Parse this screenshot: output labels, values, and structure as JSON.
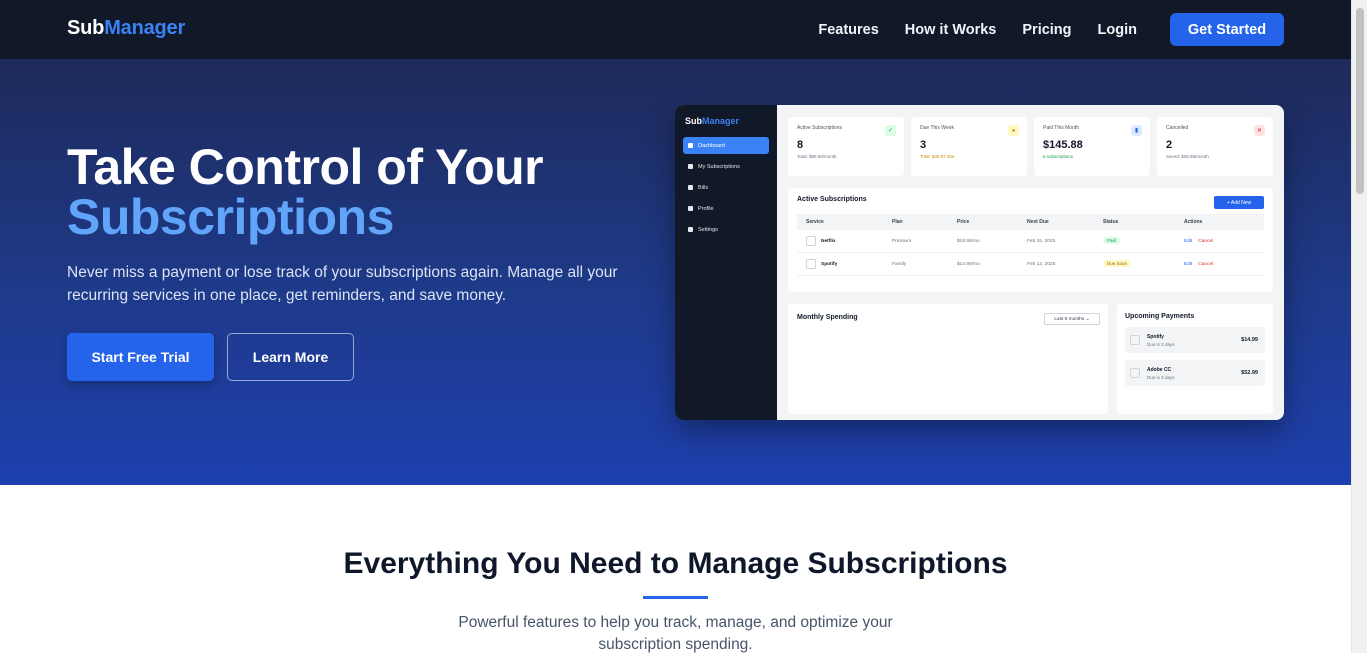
{
  "nav": {
    "logo_a": "Sub",
    "logo_b": "Manager",
    "links": [
      "Features",
      "How it Works",
      "Pricing",
      "Login"
    ],
    "cta": "Get Started"
  },
  "hero": {
    "title_line1": "Take Control of Your",
    "title_line2": "Subscriptions",
    "subtitle": "Never miss a payment or lose track of your subscriptions again. Manage all your recurring services in one place, get reminders, and save money.",
    "primary_btn": "Start Free Trial",
    "secondary_btn": "Learn More"
  },
  "preview": {
    "logo_a": "Sub",
    "logo_b": "Manager",
    "sidebar": [
      "Dashboard",
      "My Subscriptions",
      "Bills",
      "Profile",
      "Settings"
    ],
    "stats": [
      {
        "label": "Active Subscriptions",
        "value": "8",
        "note": "Total: $89.90/month",
        "icon": "✓",
        "bg": "#dcfce7",
        "fg": "#16a34a",
        "note_color": "#6b7280"
      },
      {
        "label": "Due This Week",
        "value": "3",
        "note": "Total: $35.97 due",
        "icon": "●",
        "bg": "#fef9c3",
        "fg": "#ca8a04",
        "note_color": "#ca8a04"
      },
      {
        "label": "Paid This Month",
        "value": "$145.88",
        "note": "6 subscriptions",
        "icon": "▮",
        "bg": "#dbeafe",
        "fg": "#2563eb",
        "note_color": "#16a34a"
      },
      {
        "label": "Cancelled",
        "value": "2",
        "note": "Saved: $25.98/month",
        "icon": "✕",
        "bg": "#fee2e2",
        "fg": "#dc2626",
        "note_color": "#6b7280"
      }
    ],
    "subs_title": "Active Subscriptions",
    "add_new": "+ Add New",
    "columns": [
      "Service",
      "Plan",
      "Price",
      "Next Due",
      "Status",
      "Actions"
    ],
    "rows": [
      {
        "icon_alt": "Netf",
        "service": "Netflix",
        "plan": "Premium",
        "price": "$19.99/mo",
        "next_due": "Feb 15, 2025",
        "status": "Paid",
        "status_bg": "#dcfce7",
        "status_fg": "#16a34a",
        "edit": "Edit",
        "cancel": "Cancel"
      },
      {
        "icon_alt": "Spo",
        "service": "Spotify",
        "plan": "Family",
        "price": "$14.99/mo",
        "next_due": "Feb 12, 2025",
        "status": "Due Soon",
        "status_bg": "#fef9c3",
        "status_fg": "#a16207",
        "edit": "Edit",
        "cancel": "Cancel"
      }
    ],
    "spending_title": "Monthly Spending",
    "spending_select": "Last 6 months",
    "upcoming_title": "Upcoming Payments",
    "upcoming": [
      {
        "icon_alt": "Spo",
        "name": "Spotify",
        "due": "Due in 2 days",
        "amount": "$14.99"
      },
      {
        "icon_alt": "Ado",
        "name": "Adobe CC",
        "due": "Due in 5 days",
        "amount": "$52.99"
      }
    ]
  },
  "features": {
    "title": "Everything You Need to Manage Subscriptions",
    "subtitle": "Powerful features to help you track, manage, and optimize your subscription spending."
  }
}
